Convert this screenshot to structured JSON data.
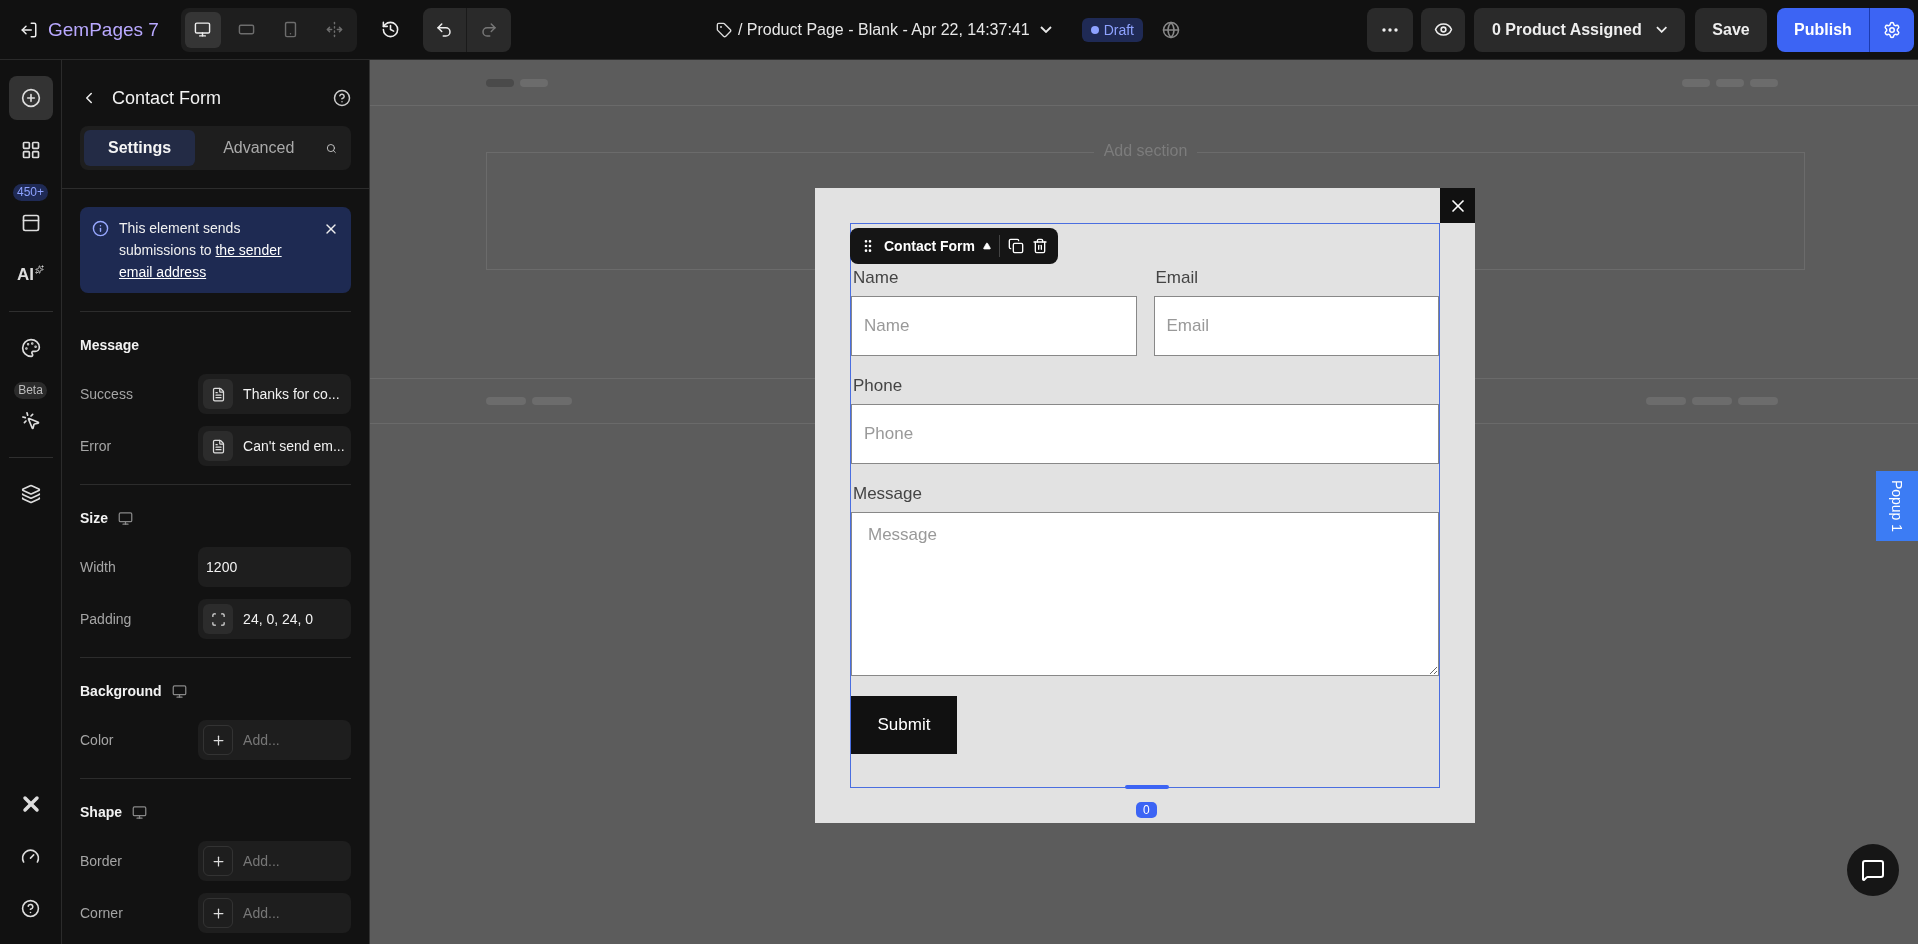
{
  "topbar": {
    "brand": "GemPages 7",
    "devices": [
      {
        "kind": "desktop",
        "selected": true
      },
      {
        "kind": "tablet",
        "selected": false
      },
      {
        "kind": "mobile",
        "selected": false
      },
      {
        "kind": "fit",
        "selected": false
      }
    ],
    "page_title": "/ Product Page - Blank - Apr 22, 14:37:41",
    "status": "Draft",
    "product_assigned": "0 Product Assigned",
    "save": "Save",
    "publish": "Publish"
  },
  "rail": {
    "items": [
      {
        "kind": "add",
        "selected": true
      },
      {
        "kind": "elements",
        "selected": false
      },
      {
        "kind": "templates",
        "badge": "450+",
        "selected": false
      },
      {
        "kind": "ai",
        "label": "AI",
        "selected": false
      },
      {
        "kind": "divider"
      },
      {
        "kind": "theme",
        "selected": false
      },
      {
        "kind": "interactions",
        "badge": "Beta",
        "selected": false
      },
      {
        "kind": "divider"
      },
      {
        "kind": "layers",
        "selected": false
      }
    ],
    "bottom": [
      {
        "kind": "logo"
      },
      {
        "kind": "speed"
      },
      {
        "kind": "help"
      }
    ]
  },
  "panel": {
    "title": "Contact Form",
    "tabs": [
      {
        "label": "Settings",
        "selected": true
      },
      {
        "label": "Advanced",
        "selected": false
      }
    ],
    "notice": {
      "text": "This element sends submissions to",
      "link": "the sender email address"
    },
    "sections": [
      {
        "title": "Message",
        "device_icon": false,
        "rows": [
          {
            "label": "Success",
            "kind": "text",
            "value": "Thanks for co..."
          },
          {
            "label": "Error",
            "kind": "text",
            "value": "Can't send em..."
          }
        ]
      },
      {
        "title": "Size",
        "device_icon": true,
        "rows": [
          {
            "label": "Width",
            "kind": "input",
            "value": "1200"
          },
          {
            "label": "Padding",
            "kind": "spacing",
            "value": "24, 0, 24, 0"
          }
        ]
      },
      {
        "title": "Background",
        "device_icon": true,
        "rows": [
          {
            "label": "Color",
            "kind": "add",
            "placeholder": "Add..."
          }
        ]
      },
      {
        "title": "Shape",
        "device_icon": true,
        "rows": [
          {
            "label": "Border",
            "kind": "add",
            "placeholder": "Add..."
          },
          {
            "label": "Corner",
            "kind": "add",
            "placeholder": "Add..."
          }
        ]
      }
    ]
  },
  "canvas": {
    "add_section": "Add section",
    "side_tab": "Popup 1",
    "popup": {
      "toolbar_label": "Contact Form",
      "spacing_badge": "0",
      "rows": [
        {
          "fields": [
            {
              "label": "Name",
              "placeholder": "Name",
              "kind": "input"
            },
            {
              "label": "Email",
              "placeholder": "Email",
              "kind": "input"
            }
          ]
        },
        {
          "fields": [
            {
              "label": "Phone",
              "placeholder": "Phone",
              "kind": "input"
            }
          ]
        },
        {
          "fields": [
            {
              "label": "Message",
              "placeholder": "Message",
              "kind": "textarea"
            }
          ]
        }
      ],
      "submit": "Submit"
    }
  }
}
